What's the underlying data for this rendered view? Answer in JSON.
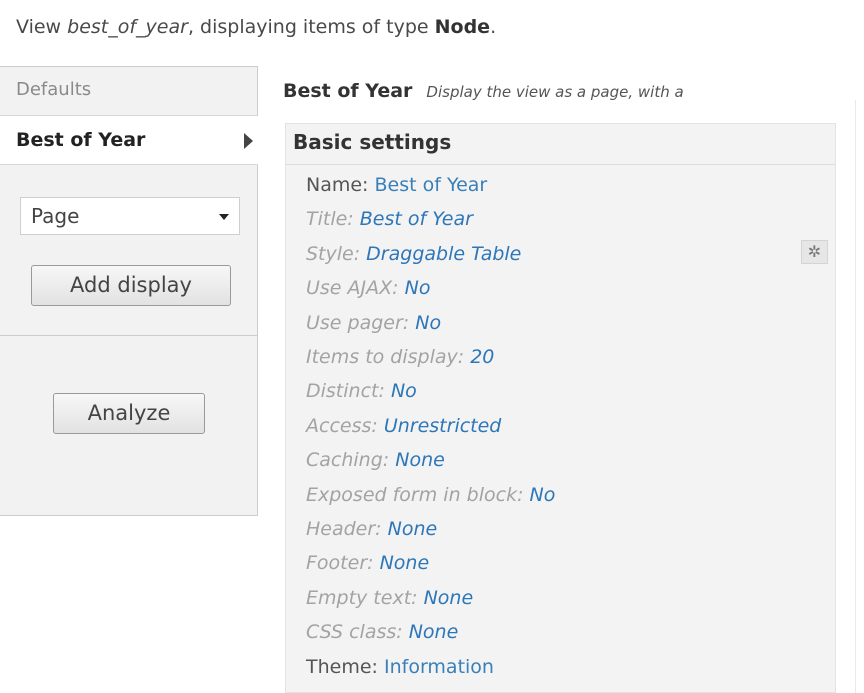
{
  "header": {
    "prefix": "View ",
    "view_name": "best_of_year",
    "middle": ", displaying items of type ",
    "type": "Node",
    "suffix": "."
  },
  "tabs": {
    "defaults_label": "Defaults",
    "active_label": "Best of Year"
  },
  "controls": {
    "display_select_value": "Page",
    "add_display_label": "Add display",
    "analyze_label": "Analyze"
  },
  "panel": {
    "title": "Best of Year",
    "description": "Display the view as a page, with a"
  },
  "basic_settings": {
    "title": "Basic settings",
    "rows": [
      {
        "label": "Name:",
        "value": "Best of Year",
        "overridden": false
      },
      {
        "label": "Title:",
        "value": "Best of Year",
        "overridden": true
      },
      {
        "label": "Style:",
        "value": "Draggable Table",
        "overridden": true
      },
      {
        "label": "Use AJAX:",
        "value": "No",
        "overridden": true
      },
      {
        "label": "Use pager:",
        "value": "No",
        "overridden": true
      },
      {
        "label": "Items to display:",
        "value": "20",
        "overridden": true
      },
      {
        "label": "Distinct:",
        "value": "No",
        "overridden": true
      },
      {
        "label": "Access:",
        "value": "Unrestricted",
        "overridden": true
      },
      {
        "label": "Caching:",
        "value": "None",
        "overridden": true
      },
      {
        "label": "Exposed form in block:",
        "value": "No",
        "overridden": true
      },
      {
        "label": "Header:",
        "value": "None",
        "overridden": true
      },
      {
        "label": "Footer:",
        "value": "None",
        "overridden": true
      },
      {
        "label": "Empty text:",
        "value": "None",
        "overridden": true
      },
      {
        "label": "CSS class:",
        "value": "None",
        "overridden": true
      },
      {
        "label": "Theme:",
        "value": "Information",
        "overridden": false
      }
    ]
  },
  "icons": {
    "gear": "gear-icon",
    "tab_arrow": "arrow-right-icon",
    "select_caret": "chevron-down-icon"
  },
  "colors": {
    "link": "#3a7fb8",
    "muted_label": "#a3a3a3",
    "sidebar_bg": "#f2f2f2",
    "settings_bg": "#f3f3f3"
  }
}
